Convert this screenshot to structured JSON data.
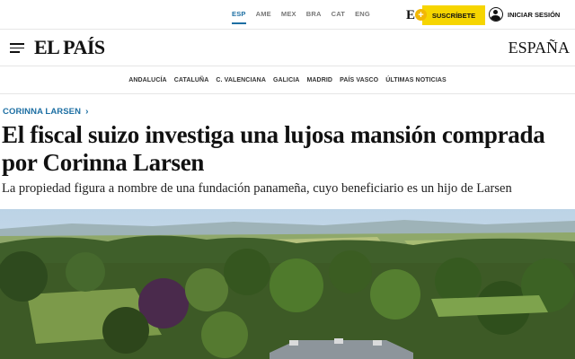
{
  "topbar": {
    "editions": [
      "ESP",
      "AME",
      "MEX",
      "BRA",
      "CAT",
      "ENG"
    ],
    "active_edition": "ESP",
    "premium_logo": "E",
    "subscribe_label": "SUSCRÍBETE",
    "login_label": "INICIAR SESIÓN"
  },
  "header": {
    "logo": "EL PAÍS",
    "section": "ESPAÑA"
  },
  "regions": [
    "ANDALUCÍA",
    "CATALUÑA",
    "C. VALENCIANA",
    "GALICIA",
    "MADRID",
    "PAÍS VASCO",
    "ÚLTIMAS NOTICIAS"
  ],
  "article": {
    "kicker": "CORINNA LARSEN",
    "headline": "El fiscal suizo investiga una lujosa mansión comprada por Corinna Larsen",
    "standfirst": "La propiedad figura a nombre de una fundación panameña, cuyo beneficiario es un hijo de Larsen"
  },
  "colors": {
    "accent": "#1d6fa3",
    "subscribe": "#f6d500",
    "premium": "#f2b705"
  },
  "icons": {
    "menu": "hamburger-icon",
    "user": "user-icon",
    "chevron": "chevron-right-icon",
    "premium": "plus-icon"
  }
}
